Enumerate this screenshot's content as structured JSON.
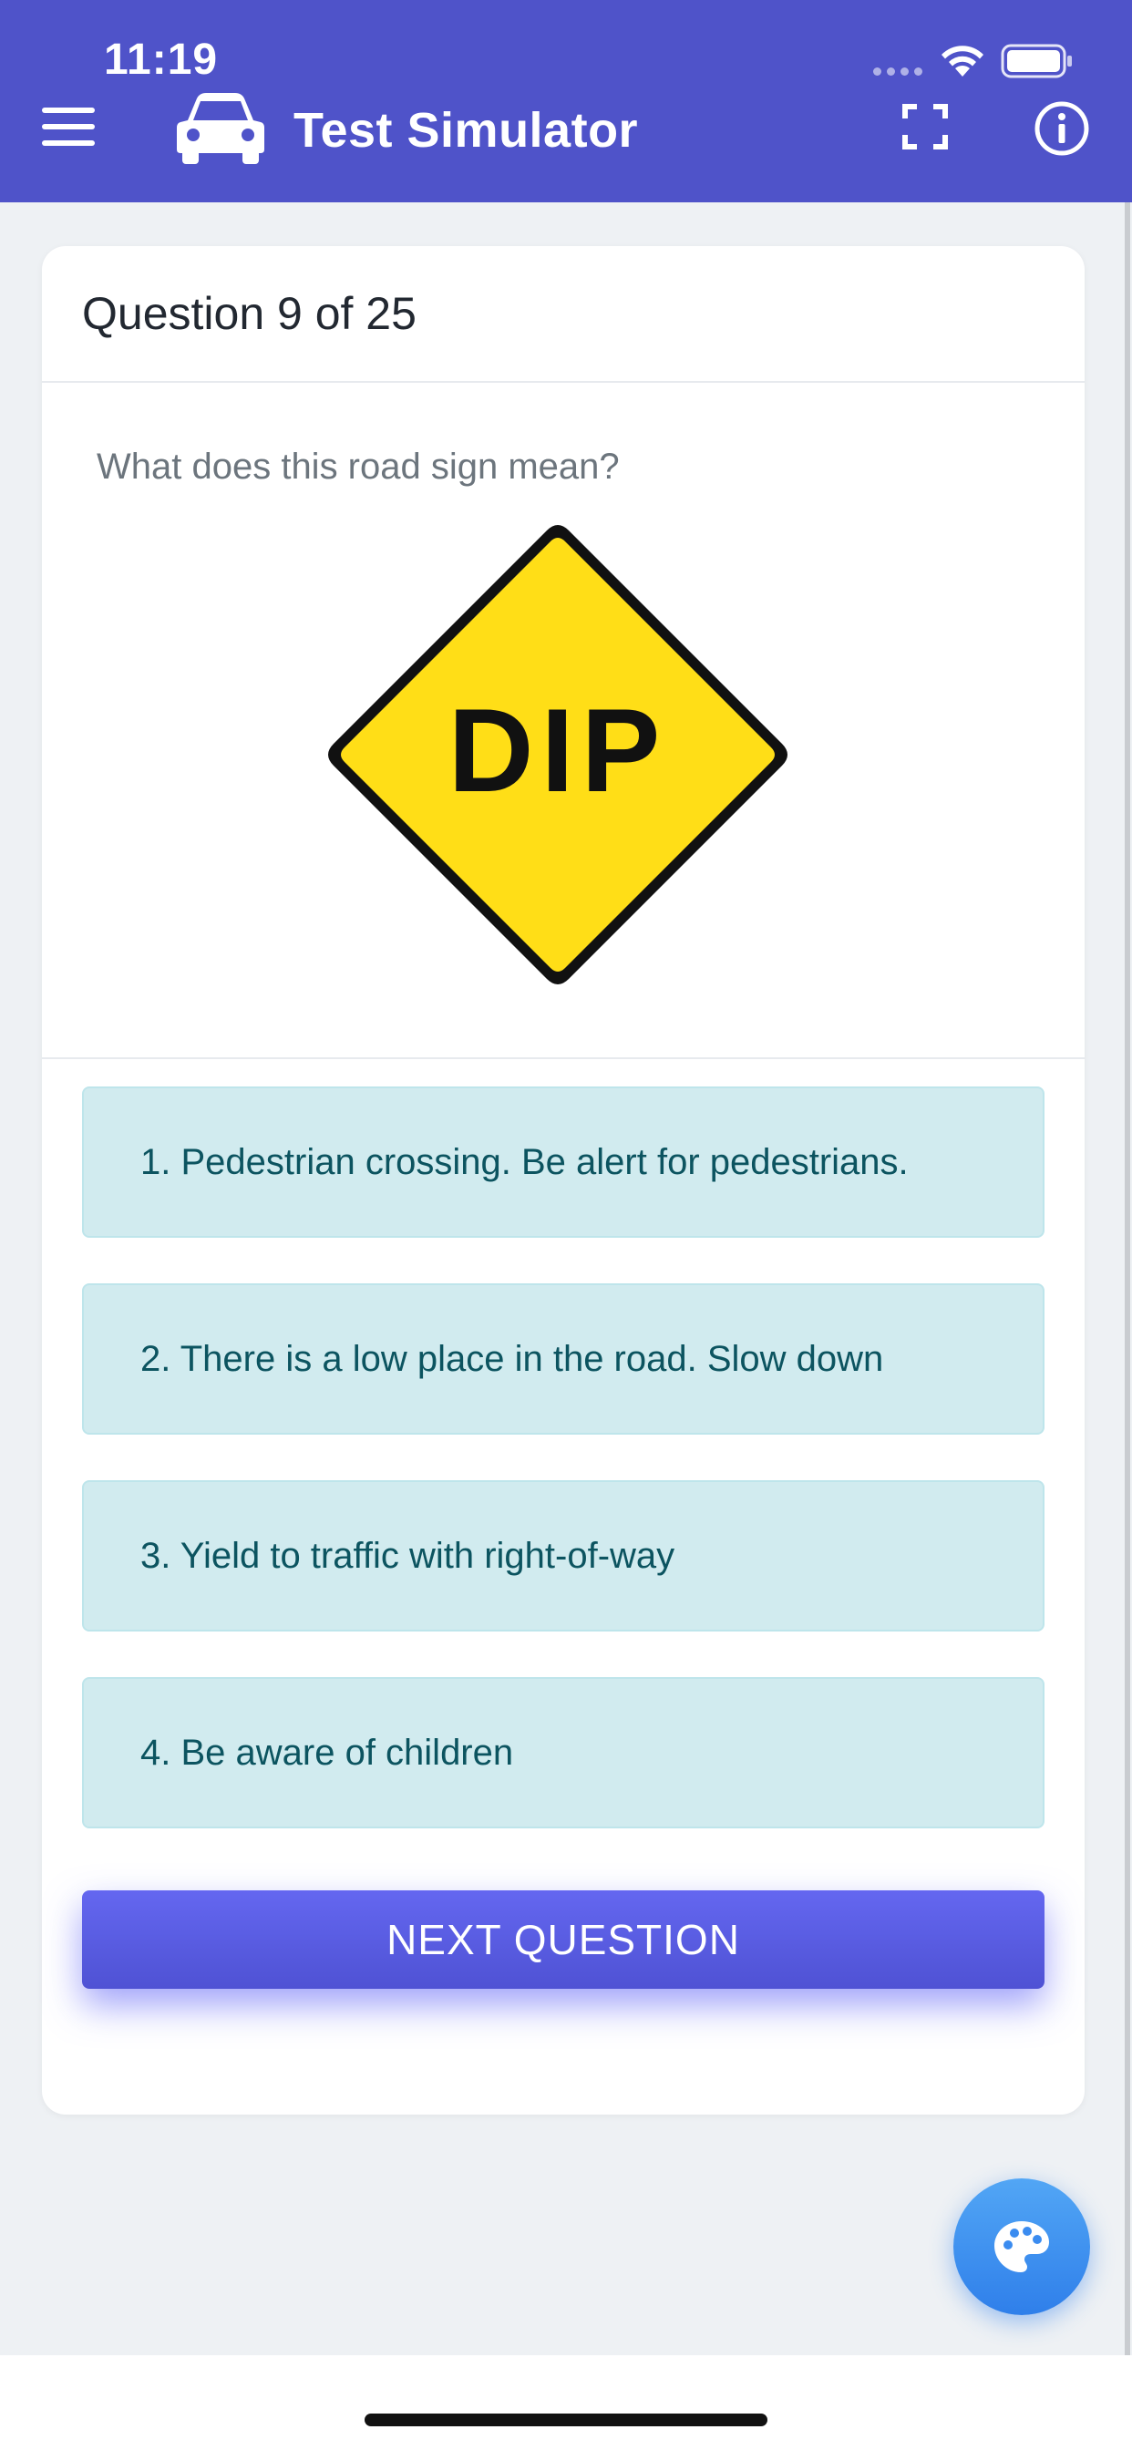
{
  "status_bar": {
    "time": "11:19"
  },
  "header": {
    "title": "Test Simulator"
  },
  "question": {
    "counter": "Question 9 of 25",
    "text": "What does this road sign mean?",
    "sign_text": "DIP"
  },
  "answers": [
    {
      "label": "1. Pedestrian crossing. Be alert for pedestrians."
    },
    {
      "label": "2. There is a low place in the road. Slow down"
    },
    {
      "label": "3. Yield to traffic with right-of-way"
    },
    {
      "label": "4. Be aware of children"
    }
  ],
  "next_button": {
    "label": "NEXT QUESTION"
  },
  "colors": {
    "header_bg": "#4f53c9",
    "answer_bg": "#d1ebef",
    "answer_text": "#0c5460",
    "next_button": "#5659e0",
    "fab": "#3b8cf0",
    "sign_yellow": "#ffde17"
  },
  "icons": [
    "hamburger-menu-icon",
    "car-icon",
    "fullscreen-icon",
    "info-icon",
    "palette-icon",
    "wifi-icon",
    "battery-icon"
  ]
}
